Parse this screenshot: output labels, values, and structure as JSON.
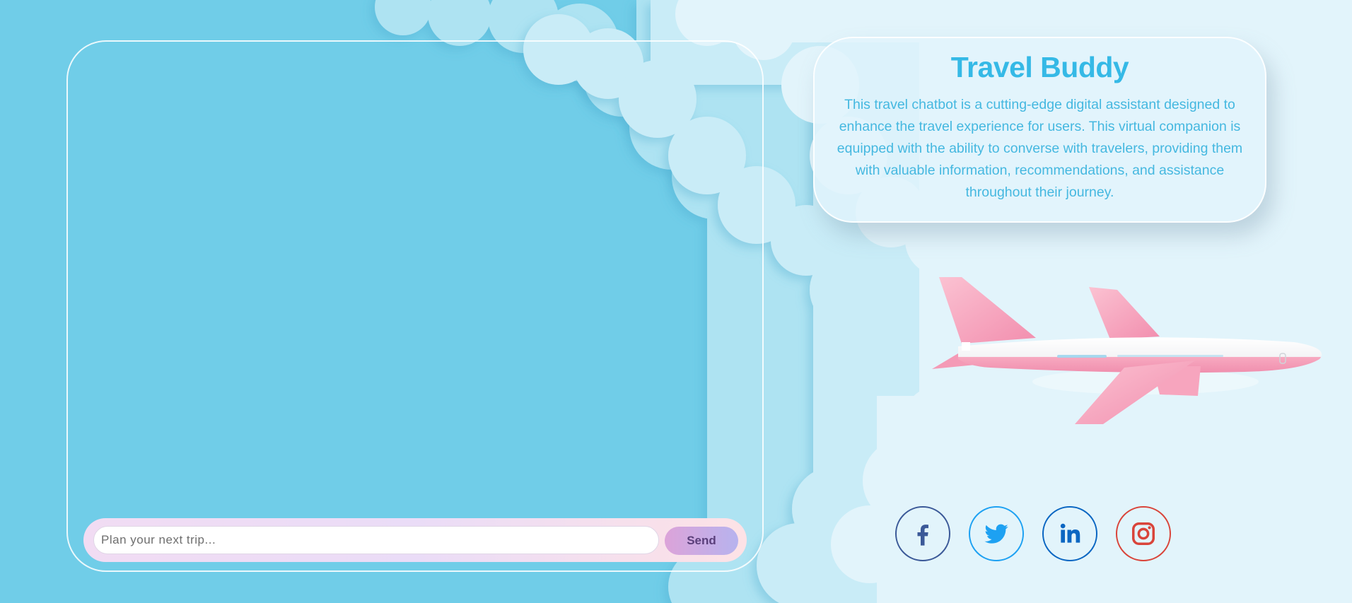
{
  "chat": {
    "placeholder": "Plan your next trip...",
    "send_label": "Send"
  },
  "info": {
    "title": "Travel Buddy",
    "description": "This travel chatbot is a cutting-edge digital assistant designed to enhance the travel experience for users. This virtual companion is equipped with the ability to converse with travelers, providing them with valuable information, recommendations, and assistance throughout their journey."
  },
  "social": [
    {
      "name": "facebook",
      "icon": "facebook-icon",
      "color": "#3b5998"
    },
    {
      "name": "twitter",
      "icon": "twitter-icon",
      "color": "#1da1f2"
    },
    {
      "name": "linkedin",
      "icon": "linkedin-icon",
      "color": "#0a66c2"
    },
    {
      "name": "instagram",
      "icon": "instagram-icon",
      "color": "#e1306c"
    }
  ],
  "colors": {
    "sky": "#70cde8",
    "cloud": "#e2f4fb",
    "accent": "#35b9e6",
    "plane": "#f5a3bd"
  }
}
